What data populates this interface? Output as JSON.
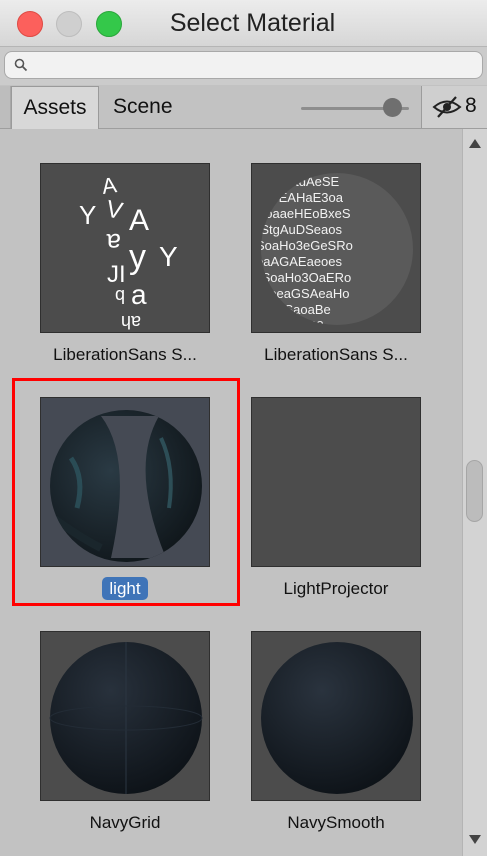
{
  "window": {
    "title": "Select Material"
  },
  "search": {
    "placeholder": "",
    "value": ""
  },
  "tabs": [
    {
      "label": "Assets",
      "active": true
    },
    {
      "label": "Scene",
      "active": false
    }
  ],
  "toolbar": {
    "hidden_count": "8"
  },
  "materials": [
    {
      "name": "LiberationSans S...",
      "selected": false
    },
    {
      "name": "LiberationSans S...",
      "selected": false
    },
    {
      "name": "light",
      "selected": true
    },
    {
      "name": "LightProjector",
      "selected": false
    },
    {
      "name": "NavyGrid",
      "selected": false
    },
    {
      "name": "NavySmooth",
      "selected": false
    }
  ],
  "colors": {
    "selection": "#3f74b8",
    "highlight": "#ff0000"
  }
}
